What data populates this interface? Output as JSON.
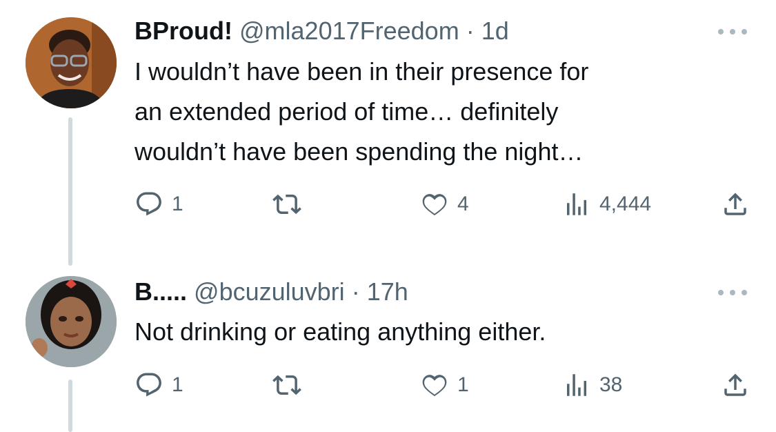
{
  "tweets": [
    {
      "display_name": "BProud!",
      "handle": "@mla2017Freedom",
      "separator": "·",
      "time": "1d",
      "text": "I wouldn’t have been in their presence for\nan extended period of time… definitely\nwouldn’t have been spending the night…",
      "replies": "1",
      "likes": "4",
      "views": "4,444"
    },
    {
      "display_name": "B.....",
      "handle": "@bcuzuluvbri",
      "separator": "·",
      "time": "17h",
      "text": "Not drinking or eating anything either.",
      "replies": "1",
      "likes": "1",
      "views": "38"
    }
  ],
  "icons": {
    "reply": "reply-icon",
    "retweet": "retweet-icon",
    "like": "like-icon",
    "views": "views-icon",
    "share": "share-icon",
    "more": "more-icon"
  },
  "colors": {
    "text": "#0f1419",
    "secondary": "#536471",
    "thread_line": "#cfd9de"
  }
}
